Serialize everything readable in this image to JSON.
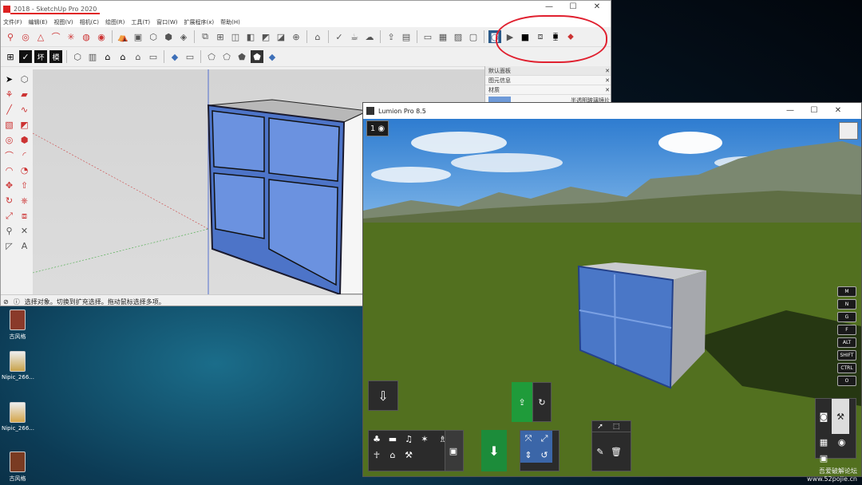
{
  "desktop": {
    "icons": [
      {
        "label": "古风格"
      },
      {
        "label": "Nipic_266..."
      },
      {
        "label": "Nipic_266..."
      },
      {
        "label": "古风格"
      }
    ],
    "watermark_line1": "吾爱破解论坛",
    "watermark_line2": "www.52pojie.cn"
  },
  "sketchup": {
    "title": "2018 - SketchUp Pro 2020",
    "menu": [
      "文件(F)",
      "编辑(E)",
      "视图(V)",
      "相机(C)",
      "绘图(R)",
      "工具(T)",
      "窗口(W)",
      "扩展程序(x)",
      "帮助(H)"
    ],
    "status": "选择对象。切换到扩充选择。拖动鼠标选择多项。",
    "tray": {
      "title": "默认面板",
      "entity": "图元信息",
      "materials": "材质",
      "material_name": "半透明玻璃镜片"
    },
    "window_controls": [
      "—",
      "☐",
      "✕"
    ],
    "toolbar_text": [
      "坏",
      "模"
    ],
    "colors": {
      "accent": "#d22020",
      "glass": "#5b84d6"
    }
  },
  "lumion": {
    "title": "Lumion Pro 8.5",
    "window_controls": [
      "—",
      "☐",
      "✕"
    ],
    "layer_label": "1",
    "keys": [
      "M",
      "N",
      "G",
      "F",
      "ALT",
      "SHIFT",
      "CTRL",
      "O"
    ]
  }
}
